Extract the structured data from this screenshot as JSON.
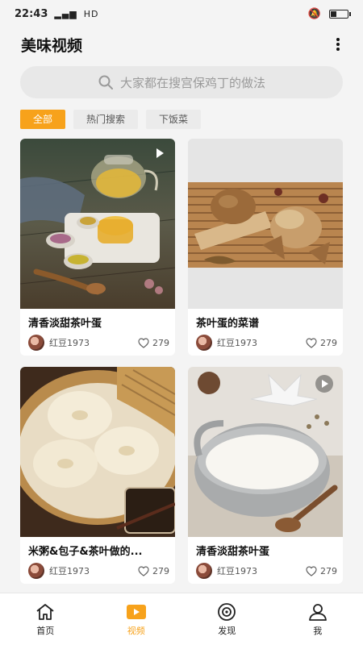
{
  "status_bar": {
    "time": "22:43",
    "network": "HD"
  },
  "header": {
    "title": "美味视频"
  },
  "search": {
    "placeholder": "大家都在搜宫保鸡丁的做法"
  },
  "tabs": [
    {
      "label": "全部",
      "active": true
    },
    {
      "label": "热门搜索",
      "active": false
    },
    {
      "label": "下饭菜",
      "active": false
    }
  ],
  "cards": [
    {
      "title": "清香淡甜茶叶蛋",
      "author": "红豆1973",
      "likes": "279",
      "has_play_icon": true
    },
    {
      "title": "茶叶蛋的菜谱",
      "author": "红豆1973",
      "likes": "279",
      "has_play_icon": false
    },
    {
      "title": "米粥&包子&茶叶做的...",
      "author": "红豆1973",
      "likes": "279",
      "has_play_icon": false
    },
    {
      "title": "清香淡甜茶叶蛋",
      "author": "红豆1973",
      "likes": "279",
      "has_play_icon": true
    }
  ],
  "nav": [
    {
      "label": "首页",
      "icon": "home-icon",
      "active": false
    },
    {
      "label": "视频",
      "icon": "video-icon",
      "active": true
    },
    {
      "label": "发现",
      "icon": "discover-icon",
      "active": false
    },
    {
      "label": "我",
      "icon": "profile-icon",
      "active": false
    }
  ],
  "colors": {
    "accent": "#f7a21b",
    "background": "#f4f4f4",
    "search_bg": "#e8e8e8"
  }
}
